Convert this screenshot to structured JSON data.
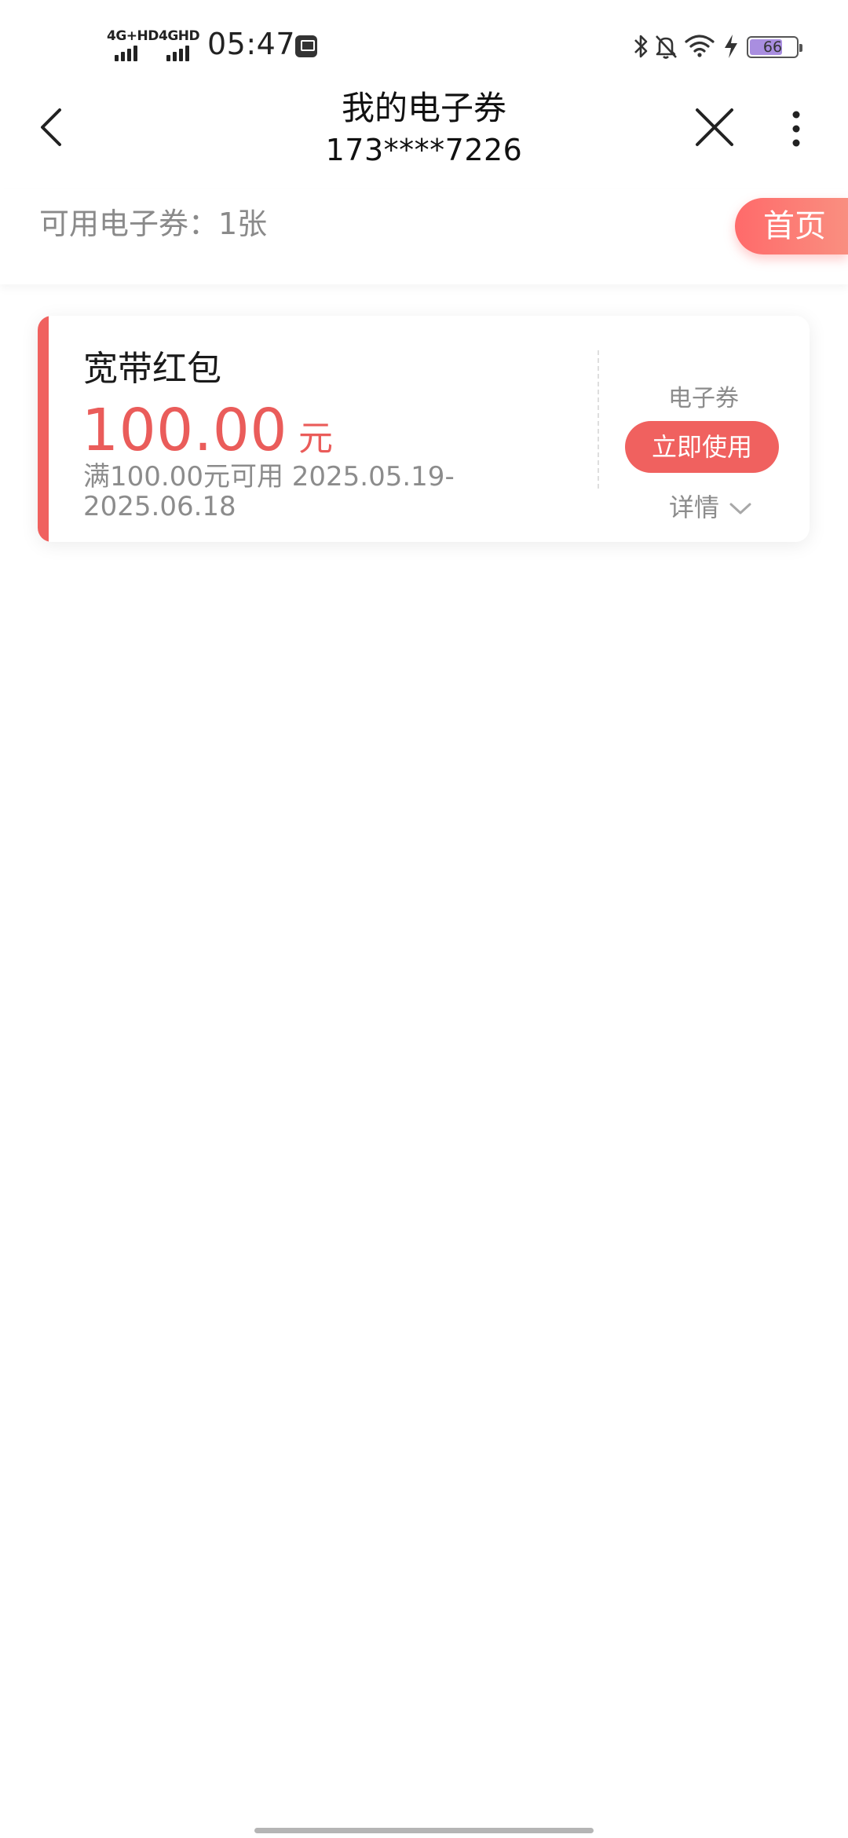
{
  "status_bar": {
    "network_1": "4G+HD",
    "network_2": "4GHD",
    "time": "05:47",
    "battery_level": "66",
    "icons": [
      "screenshot-app-icon",
      "bluetooth-icon",
      "mute-bell-icon",
      "wifi-icon",
      "charging-icon",
      "battery-icon"
    ]
  },
  "nav": {
    "title": "我的电子券",
    "subtitle": "173****7226",
    "icons": [
      "back-arrow-icon",
      "close-icon",
      "more-vertical-icon"
    ]
  },
  "summary": {
    "available_text": "可用电子券：1张",
    "home_button": "首页"
  },
  "coupons": [
    {
      "name": "宽带红包",
      "amount": "100.00",
      "unit": "元",
      "condition": "满100.00元可用 2025.05.19-2025.06.18",
      "type_label": "电子券",
      "use_button": "立即使用",
      "detail_label": "详情"
    }
  ],
  "colors": {
    "accent": "#f0615f",
    "amount_text": "#ea5c5a",
    "muted_text": "#8c8c8c",
    "battery_fill": "#a98ee0"
  }
}
